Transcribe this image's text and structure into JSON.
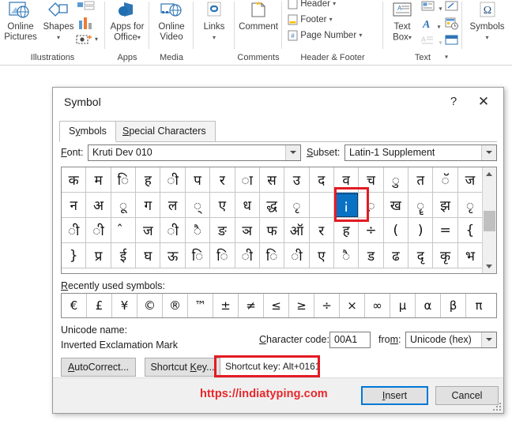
{
  "ribbon": {
    "groups": [
      {
        "label": "Illustrations",
        "buttons": [
          {
            "label_line1": "Online",
            "label_line2": "Pictures",
            "icon": "online-pictures-icon"
          },
          {
            "label_line1": "Shapes",
            "label_line2": "",
            "icon": "shapes-icon"
          }
        ],
        "small_buttons": [
          {
            "label": "",
            "icon": "smartart-icon"
          },
          {
            "label": "",
            "icon": "chart-icon"
          },
          {
            "label": "",
            "icon": "screenshot-icon"
          }
        ]
      },
      {
        "label": "Apps",
        "buttons": [
          {
            "label_line1": "Apps for",
            "label_line2": "Office",
            "icon": "apps-for-office-icon"
          }
        ],
        "small_buttons": []
      },
      {
        "label": "Media",
        "buttons": [
          {
            "label_line1": "Online",
            "label_line2": "Video",
            "icon": "online-video-icon"
          }
        ],
        "small_buttons": []
      },
      {
        "label": "",
        "buttons": [
          {
            "label_line1": "Links",
            "label_line2": "",
            "icon": "links-icon"
          }
        ],
        "small_buttons": []
      },
      {
        "label": "Comments",
        "buttons": [
          {
            "label_line1": "Comment",
            "label_line2": "",
            "icon": "comment-icon"
          }
        ],
        "small_buttons": []
      },
      {
        "label": "Header & Footer",
        "buttons": [],
        "small_buttons": [
          {
            "label": "Header",
            "icon": "header-icon"
          },
          {
            "label": "Footer",
            "icon": "footer-icon"
          },
          {
            "label": "Page Number",
            "icon": "page-number-icon"
          }
        ]
      },
      {
        "label": "Text",
        "buttons": [
          {
            "label_line1": "Text",
            "label_line2": "Box",
            "icon": "text-box-icon"
          }
        ],
        "small_buttons": [
          {
            "label": "",
            "icon": "quick-parts-icon"
          },
          {
            "label": "",
            "icon": "signature-line-icon"
          },
          {
            "label": "",
            "icon": "wordart-icon"
          },
          {
            "label": "",
            "icon": "date-time-icon"
          },
          {
            "label": "",
            "icon": "drop-cap-icon"
          },
          {
            "label": "",
            "icon": "object-icon"
          }
        ]
      },
      {
        "label": "",
        "buttons": [
          {
            "label_line1": "Symbols",
            "label_line2": "",
            "icon": "omega-icon"
          }
        ],
        "small_buttons": []
      }
    ]
  },
  "dialog": {
    "title": "Symbol",
    "help_glyph": "?",
    "close_glyph": "✕",
    "tabs": [
      {
        "label_pre": "S",
        "label_underline": "y",
        "label_post": "mbols",
        "active": true
      },
      {
        "label_pre": "",
        "label_underline": "S",
        "label_post": "pecial Characters",
        "active": false
      }
    ],
    "font_label_pre": "",
    "font_label_underline": "F",
    "font_label_post": "ont:",
    "font_value": "Kruti Dev 010",
    "subset_label_pre": "",
    "subset_label_underline": "S",
    "subset_label_post": "ubset:",
    "subset_value": "Latin-1 Supplement",
    "grid": {
      "rows": [
        [
          "क",
          "म",
          "ि",
          "ह",
          "ी",
          "प",
          "र",
          "ा",
          "स",
          "उ",
          "द",
          "व",
          "च",
          "ु",
          "त",
          "ॅ",
          "ज"
        ],
        [
          "न",
          "अ",
          "ू",
          "ग",
          "ल",
          "्",
          "ए",
          "ध",
          "द्ध",
          "ृ",
          " ",
          "¡",
          "़",
          "ख",
          "ॄ",
          "झ",
          "ृ"
        ],
        [
          "ी",
          "ी",
          "̂",
          "ज",
          "ी",
          "ै",
          "ङ",
          "ञ",
          "फ",
          "ऑ",
          "र",
          "ह",
          "÷",
          "(",
          ")",
          "=",
          "{"
        ],
        [
          "}",
          "प्र",
          "ई",
          "घ",
          "ऊ",
          "ि",
          "ि",
          "ी",
          "ि",
          "ी",
          "ए",
          "ै",
          "ड",
          "ढ",
          "दृ",
          "कृ",
          "भ"
        ]
      ],
      "selected_row": 1,
      "selected_col": 11,
      "selected_char": "¡"
    },
    "recent_label_pre": "",
    "recent_label_underline": "R",
    "recent_label_post": "ecently used symbols:",
    "recent_symbols": [
      "€",
      "£",
      "¥",
      "©",
      "®",
      "™",
      "±",
      "≠",
      "≤",
      "≥",
      "÷",
      "×",
      "∞",
      "µ",
      "α",
      "β",
      "π"
    ],
    "unicode_name_label": "Unicode name:",
    "unicode_name_value": "Inverted Exclamation Mark",
    "charcode_label_pre": "",
    "charcode_label_underline": "C",
    "charcode_label_post": "haracter code:",
    "charcode_value": "00A1",
    "from_label_pre": "fro",
    "from_label_underline": "m",
    "from_label_post": ":",
    "from_value": "Unicode (hex)",
    "autocorrect_pre": "",
    "autocorrect_underline": "A",
    "autocorrect_post": "utoCorrect...",
    "shortcutkey_pre": "Shortcut ",
    "shortcutkey_underline": "K",
    "shortcutkey_post": "ey...",
    "shortcut_note": "Shortcut key: Alt+0161",
    "watermark": "https://indiatyping.com",
    "insert_pre": "",
    "insert_underline": "I",
    "insert_post": "nsert",
    "cancel_label": "Cancel"
  },
  "colors": {
    "accent_blue": "#0a72c4",
    "focus_blue": "#0078d7",
    "annotation_red": "#e31b23",
    "watermark_red": "#e8262a",
    "ribbon_icon_blue": "#2e75b6"
  }
}
